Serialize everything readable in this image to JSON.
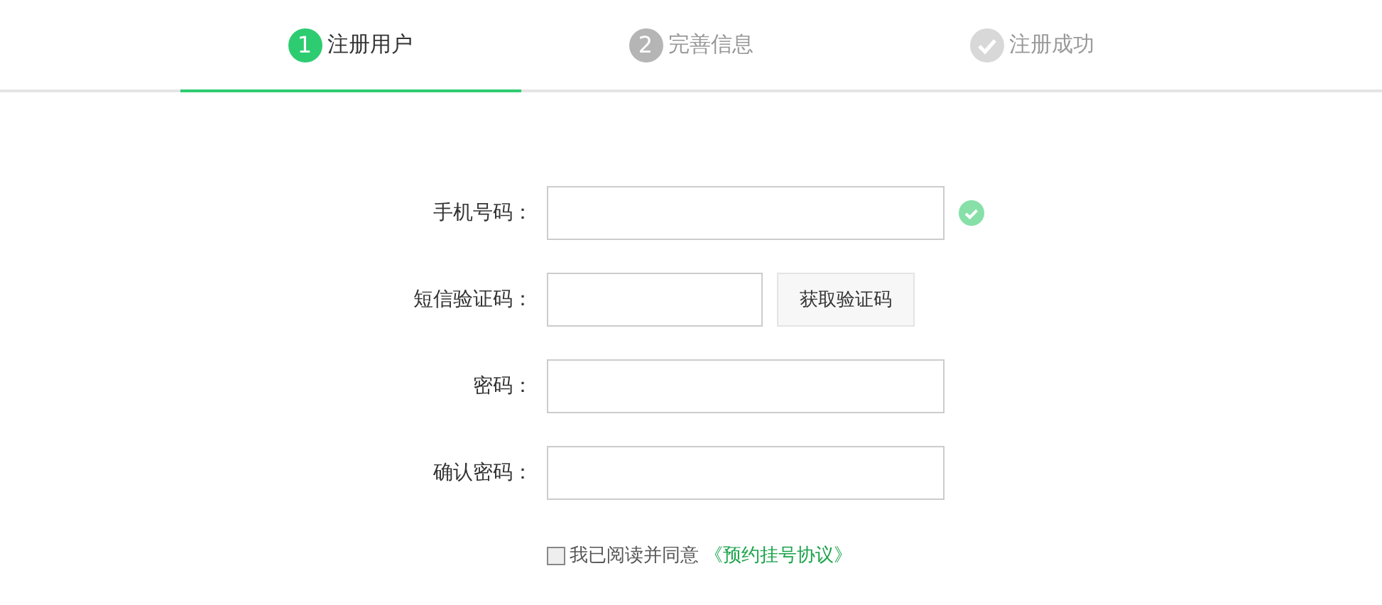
{
  "steps": [
    {
      "kind": "number",
      "number": "1",
      "label": "注册用户",
      "selected": true
    },
    {
      "kind": "number",
      "number": "2",
      "label": "完善信息",
      "selected": false
    },
    {
      "kind": "done",
      "label": "注册成功",
      "selected": false
    }
  ],
  "fields": [
    {
      "label": "手机号码：",
      "kind": "text",
      "valid": true
    },
    {
      "label": "短信验证码：",
      "kind": "code",
      "button": "获取验证码",
      "valid": false
    },
    {
      "label": "密码：",
      "kind": "text",
      "valid": false
    },
    {
      "label": "确认密码：",
      "kind": "text",
      "valid": false
    }
  ],
  "agreement": {
    "checked": false,
    "text": "我已阅读并同意",
    "link": "《预约挂号协议》"
  }
}
